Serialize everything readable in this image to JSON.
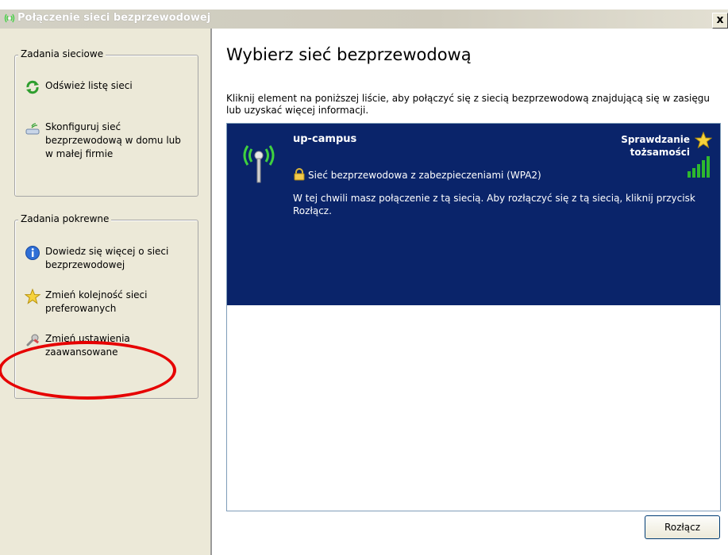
{
  "window": {
    "title": "Połączenie sieci bezprzewodowej",
    "close_label": "x"
  },
  "sidebar": {
    "network_tasks": {
      "title": "Zadania sieciowe",
      "items": [
        {
          "label": "Odśwież listę sieci",
          "icon": "refresh-icon"
        },
        {
          "label": "Skonfiguruj sieć bezprzewodową w domu lub w małej firmie",
          "icon": "wireless-setup-icon"
        }
      ]
    },
    "related_tasks": {
      "title": "Zadania pokrewne",
      "items": [
        {
          "label": "Dowiedz się więcej o sieci bezprzewodowej",
          "icon": "info-icon"
        },
        {
          "label": "Zmień kolejność sieci preferowanych",
          "icon": "star-icon"
        },
        {
          "label": "Zmień ustawienia zaawansowane",
          "icon": "wrench-icon"
        }
      ]
    }
  },
  "main": {
    "title": "Wybierz sieć bezprzewodową",
    "description": "Kliknij element na poniższej liście, aby połączyć się z siecią bezprzewodową znajdującą się w zasięgu lub uzyskać więcej informacji.",
    "networks": [
      {
        "name": "up-campus",
        "status": "Sprawdzanie tożsamości",
        "security": "Sieć bezprzewodowa z zabezpieczeniami (WPA2)",
        "info": "W tej chwili masz połączenie z tą siecią. Aby rozłączyć się z tą siecią, kliknij przycisk Rozłącz.",
        "signal_bars": 5
      }
    ],
    "disconnect_button": "Rozłącz"
  },
  "colors": {
    "selected_bg": "#0a246a",
    "highlight": "#e60000",
    "signal": "#2eb82e"
  }
}
